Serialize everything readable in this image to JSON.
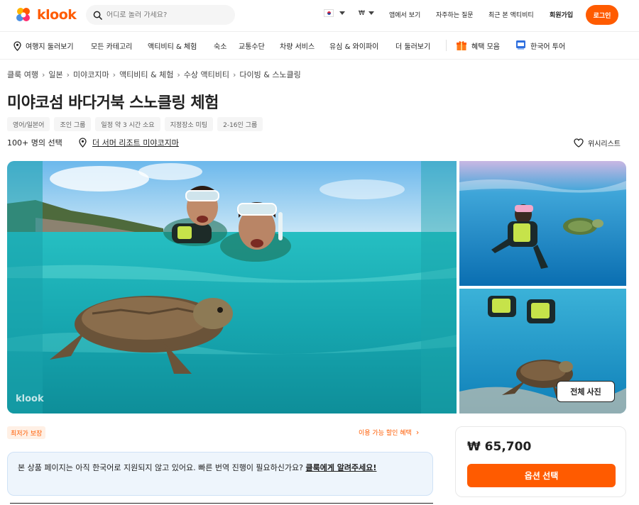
{
  "header": {
    "logo_text": "klook",
    "search_placeholder": "어디로 놀러 가세요?",
    "currency": "₩",
    "app_link": "앱에서 보기",
    "faq": "자주하는 질문",
    "recent": "최근 본 액티비티",
    "signup": "회원가입",
    "login": "로그인",
    "brand_color": "#ff5b00"
  },
  "nav": {
    "items": [
      "여행지 둘러보기",
      "모든 카테고리",
      "액티비티 & 체험",
      "숙소",
      "교통수단",
      "차량 서비스",
      "유심 & 와이파이",
      "더 둘러보기"
    ],
    "promo": "혜택 모음",
    "korean_tour": "한국어 투어"
  },
  "breadcrumb": [
    "클룩 여행",
    "일본",
    "미야코지마",
    "액티비티 & 체험",
    "수상 액티비티",
    "다이빙 & 스노클링"
  ],
  "product": {
    "title": "미야코섬 바다거북 스노클링 체험",
    "tags": [
      "영어/일본어",
      "조인 그룹",
      "일정 약 3 시간 소요",
      "지정장소 미팅",
      "2-16인 그룹"
    ],
    "booked": "100+ 명의 선택",
    "location": "더 서머 리조트 미야코지마",
    "wishlist": "위시리스트"
  },
  "gallery": {
    "all_photos": "전체 사진",
    "watermark": "klook"
  },
  "offers": {
    "best_price": "최저가 보장",
    "discount": "이용 가능 할인 혜택"
  },
  "notice": {
    "text": "본 상품 페이지는 아직 한국어로 지원되지 않고 있어요. 빠른 번역 진행이 필요하신가요? ",
    "link": "클룩에게 알려주세요!"
  },
  "booking": {
    "price": "₩ 65,700",
    "select_option": "옵션 선택"
  }
}
